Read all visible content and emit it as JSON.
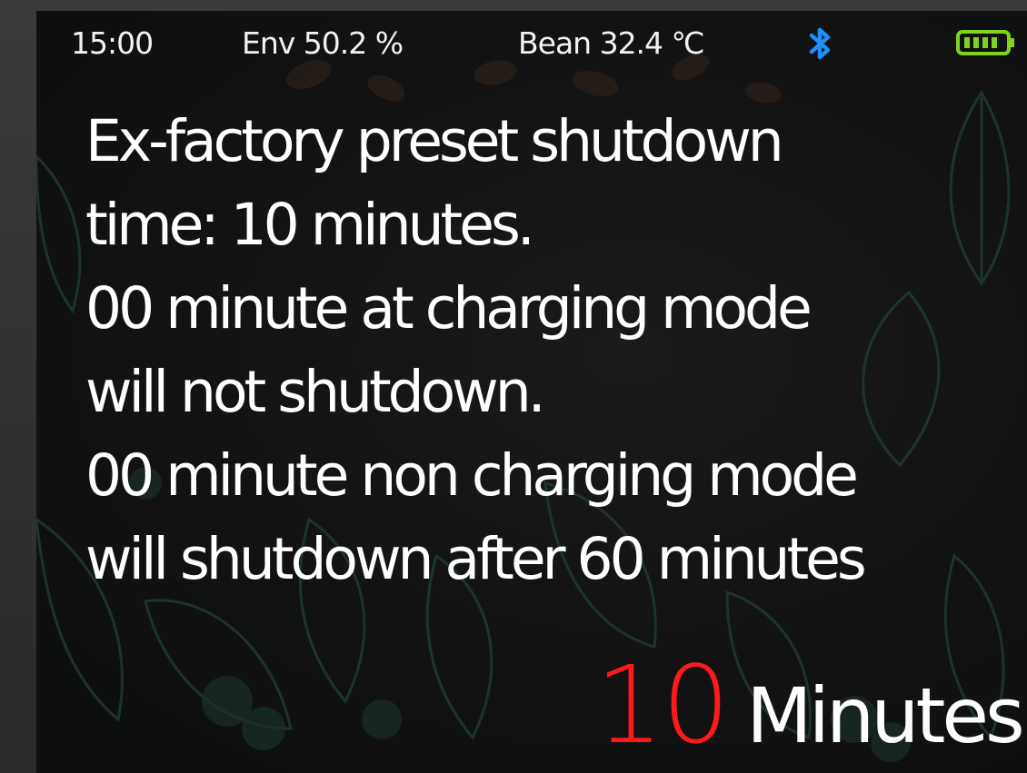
{
  "status_bar": {
    "time": "15:00",
    "env": "Env 50.2  %",
    "bean": "Bean 32.4  ℃",
    "bluetooth_icon": "bluetooth-icon",
    "battery_icon": "battery-full-icon",
    "bluetooth_color": "#1e90ff",
    "battery_color": "#7ed321"
  },
  "message": {
    "lines": [
      "Ex-factory preset shutdown",
      "time: 10 minutes.",
      "00 minute at charging mode",
      "will not shutdown.",
      "00 minute non charging mode",
      "will shutdown after 60 minutes"
    ]
  },
  "setting": {
    "value": "10",
    "unit": "Minutes",
    "value_color": "#ff1a1a"
  }
}
